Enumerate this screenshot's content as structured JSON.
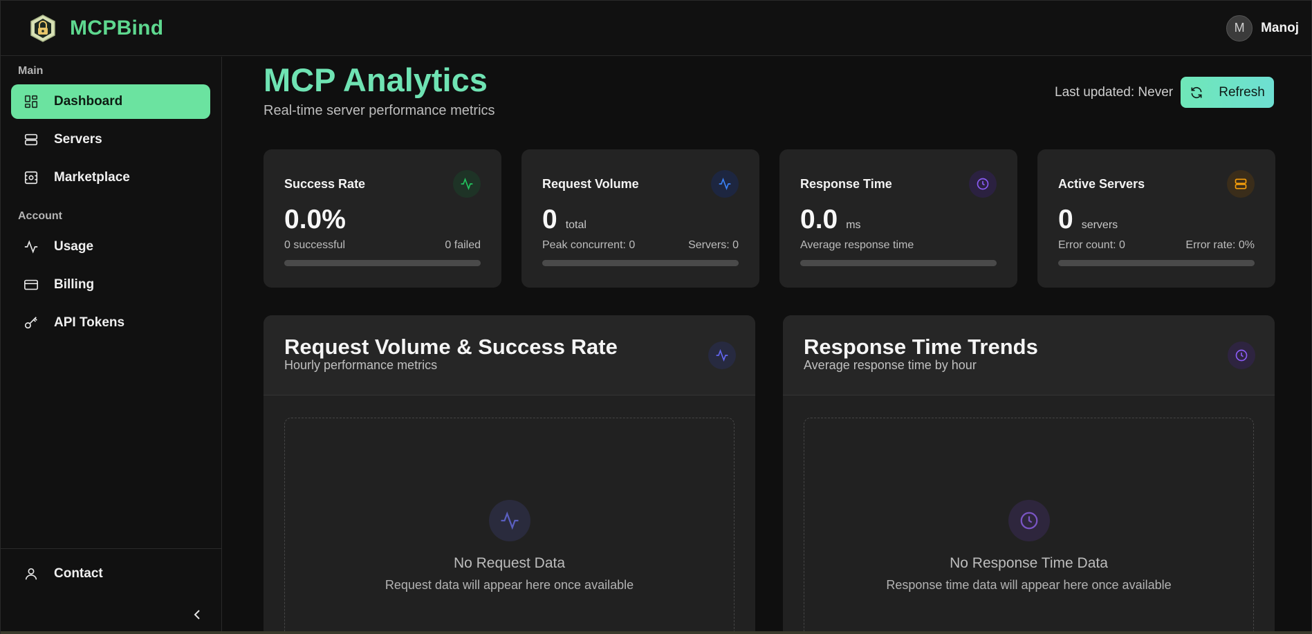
{
  "app": {
    "name": "MCPBind"
  },
  "user": {
    "initial": "M",
    "name": "Manoj"
  },
  "sidebar": {
    "sections": [
      {
        "label": "Main"
      },
      {
        "label": "Account"
      }
    ],
    "items": [
      {
        "label": "Dashboard",
        "icon": "dashboard-icon"
      },
      {
        "label": "Servers",
        "icon": "servers-icon"
      },
      {
        "label": "Marketplace",
        "icon": "marketplace-icon"
      },
      {
        "label": "Usage",
        "icon": "activity-icon"
      },
      {
        "label": "Billing",
        "icon": "credit-card-icon"
      },
      {
        "label": "API Tokens",
        "icon": "key-icon"
      },
      {
        "label": "Contact",
        "icon": "user-icon"
      }
    ]
  },
  "header": {
    "title": "MCP Analytics",
    "subtitle": "Real-time server performance metrics",
    "last_updated": "Last updated: Never",
    "refresh_label": "Refresh"
  },
  "stats": [
    {
      "title": "Success Rate",
      "value": "0.0%",
      "unit": "",
      "left": "0 successful",
      "right": "0 failed",
      "accent": "#22c55e"
    },
    {
      "title": "Request Volume",
      "value": "0",
      "unit": "total",
      "left": "Peak concurrent: 0",
      "right": "Servers: 0",
      "accent": "#3b82f6"
    },
    {
      "title": "Response Time",
      "value": "0.0",
      "unit": "ms",
      "left": "Average response time",
      "right": "",
      "accent": "#8b5cf6"
    },
    {
      "title": "Active Servers",
      "value": "0",
      "unit": "servers",
      "left": "Error count: 0",
      "right": "Error rate: 0%",
      "accent": "#f59e0b"
    }
  ],
  "panels": [
    {
      "title": "Request Volume & Success Rate",
      "subtitle": "Hourly performance metrics",
      "empty_title": "No Request Data",
      "empty_sub": "Request data will appear here once available",
      "accent": "#6366f1"
    },
    {
      "title": "Response Time Trends",
      "subtitle": "Average response time by hour",
      "empty_title": "No Response Time Data",
      "empty_sub": "Response time data will appear here once available",
      "accent": "#8b5cf6"
    }
  ]
}
